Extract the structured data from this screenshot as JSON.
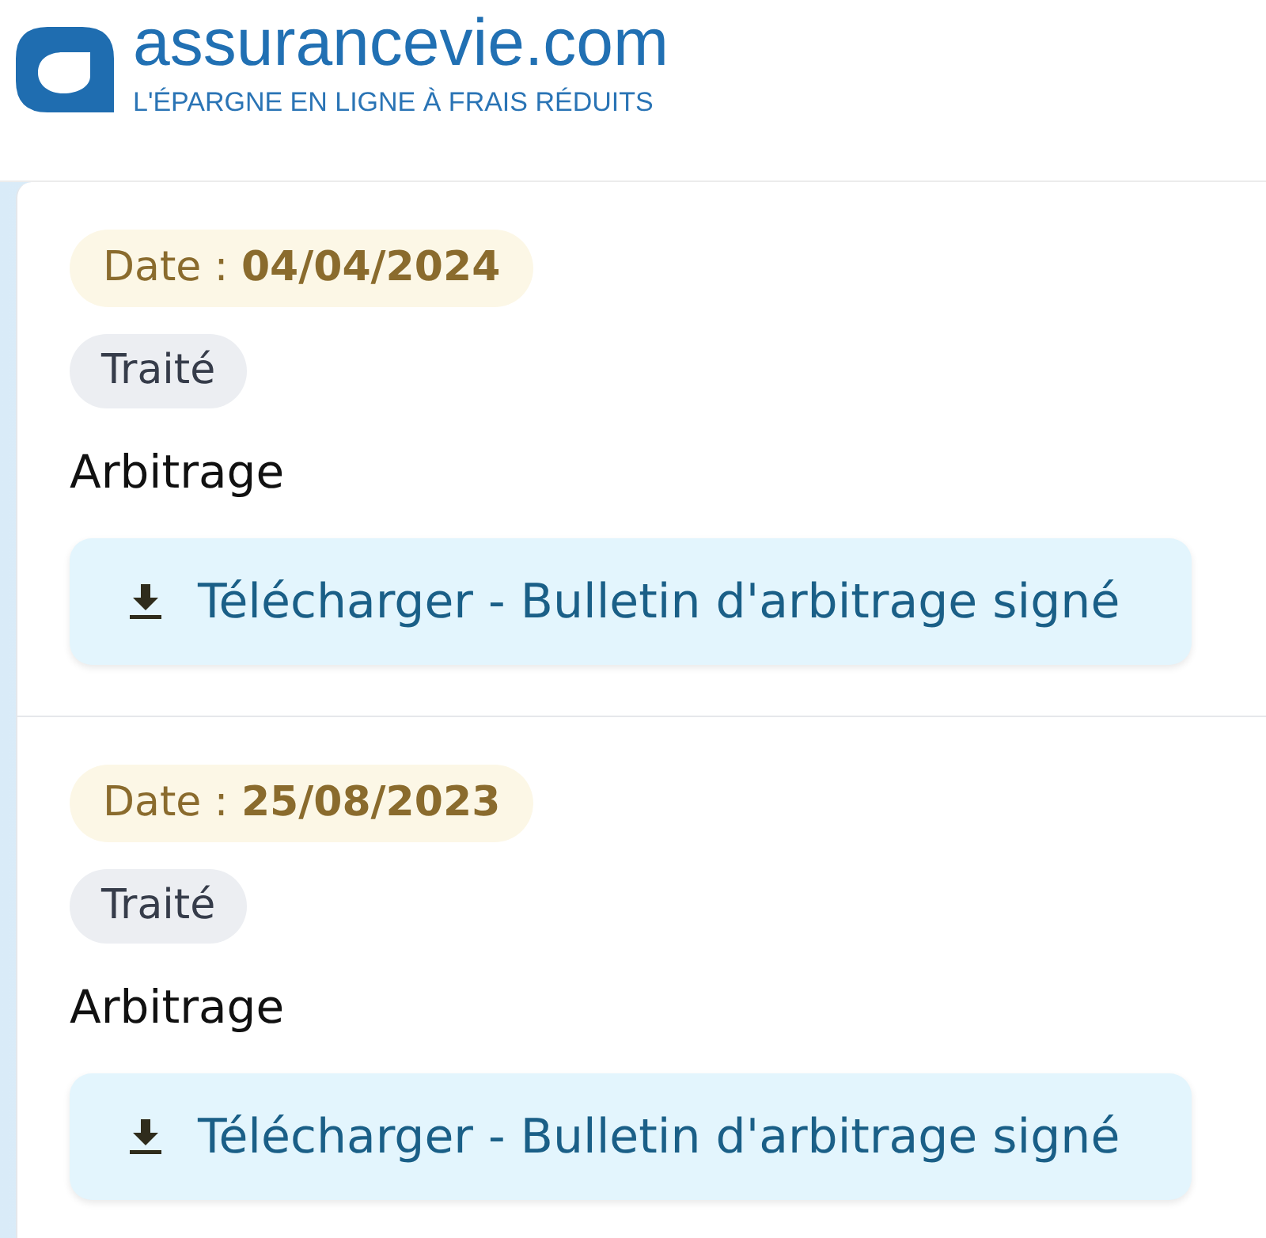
{
  "header": {
    "logo": {
      "name": "assurancevie.com",
      "tagline": "L'ÉPARGNE EN LIGNE À FRAIS RÉDUITS"
    }
  },
  "operations": [
    {
      "date": "Date : **04/04/2024**",
      "status": "Traité",
      "type": "Arbitrage",
      "download_label": "Télécharger - Bulletin d'arbitrage signé"
    },
    {
      "date": "Date : **25/08/2023**",
      "status": "Traité",
      "type": "Arbitrage",
      "download_label": "Télécharger - Bulletin d'arbitrage signé"
    }
  ]
}
